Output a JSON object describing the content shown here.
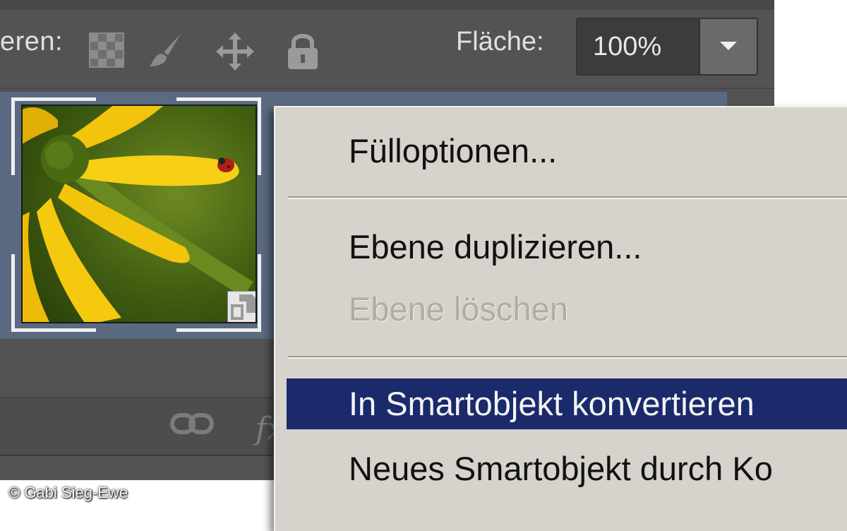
{
  "lock_bar": {
    "label": "eren:",
    "icons": [
      "lock-transparent-pixels-icon",
      "lock-image-pixels-icon",
      "lock-position-icon",
      "lock-all-icon"
    ],
    "fill_label": "Fläche:",
    "fill_value": "100%"
  },
  "layer": {
    "thumbnail": "yellow-flower-with-ladybug",
    "badge": "smart-object-badge-icon"
  },
  "bottom_bar": {
    "icons": [
      "link-layers-icon",
      "fx-icon"
    ],
    "fx_label": "fx"
  },
  "context_menu": {
    "items": [
      {
        "label": "Fülloptionen...",
        "enabled": true
      },
      {
        "label": "Ebene duplizieren...",
        "enabled": true
      },
      {
        "label": "Ebene löschen",
        "enabled": false
      },
      {
        "label": "In Smartobjekt konvertieren",
        "enabled": true,
        "highlighted": true
      },
      {
        "label": "Neues Smartobjekt durch Ko",
        "enabled": true
      }
    ]
  },
  "colors": {
    "panel_bg": "#535353",
    "selected_layer": "#5a6a80",
    "menu_bg": "#d6d2cc",
    "menu_highlight": "#1a2a6b"
  },
  "copyright": "© Gabi Sieg-Ewe"
}
